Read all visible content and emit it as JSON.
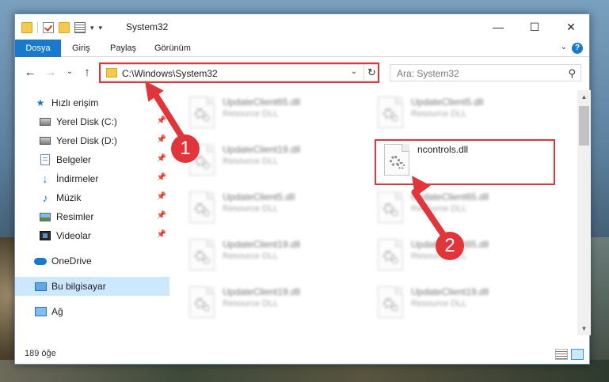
{
  "window": {
    "title": "System32",
    "controls": {
      "minimize": "—",
      "maximize": "☐",
      "close": "✕"
    }
  },
  "quick_access_toolbar": {
    "dropdown": "▾"
  },
  "ribbon": {
    "tabs": [
      "Dosya",
      "Giriş",
      "Paylaş",
      "Görünüm"
    ],
    "expand": "⌄",
    "help": "?"
  },
  "navigation": {
    "back": "←",
    "forward": "→",
    "recent": "⌄",
    "up": "↑",
    "address": "C:\\Windows\\System32",
    "address_dropdown": "⌄",
    "refresh": "↻",
    "search_placeholder": "Ara: System32",
    "search_icon": "⚲"
  },
  "sidebar": {
    "items": [
      {
        "label": "Hızlı erişim",
        "icon": "star-icon",
        "pinned": false
      },
      {
        "label": "Yerel Disk (C:)",
        "icon": "disk-icon",
        "pinned": true
      },
      {
        "label": "Yerel Disk (D:)",
        "icon": "disk-icon",
        "pinned": true
      },
      {
        "label": "Belgeler",
        "icon": "documents-icon",
        "pinned": true
      },
      {
        "label": "İndirmeler",
        "icon": "download-icon",
        "pinned": true
      },
      {
        "label": "Müzik",
        "icon": "music-icon",
        "pinned": true
      },
      {
        "label": "Resimler",
        "icon": "pictures-icon",
        "pinned": true
      },
      {
        "label": "Videolar",
        "icon": "videos-icon",
        "pinned": true
      },
      {
        "label": "OneDrive",
        "icon": "onedrive-icon",
        "pinned": false
      },
      {
        "label": "Bu bilgisayar",
        "icon": "this-pc-icon",
        "pinned": false,
        "selected": true
      },
      {
        "label": "Ağ",
        "icon": "network-icon",
        "pinned": false
      }
    ],
    "pin_glyph": "📌"
  },
  "files": [
    {
      "name": "UpdateClient65.dll",
      "type": "Resource DLL",
      "blurred": true
    },
    {
      "name": "UpdateClient5.dll",
      "type": "Resource DLL",
      "blurred": true
    },
    {
      "name": "UpdateClient19.dll",
      "type": "Resource DLL",
      "blurred": true
    },
    {
      "name": "ncontrols.dll",
      "type": "",
      "blurred": false,
      "highlighted": true
    },
    {
      "name": "UpdateClient5.dll",
      "type": "Resource DLL",
      "blurred": true
    },
    {
      "name": "UpdateClient65.dll",
      "type": "Resource DLL",
      "blurred": true
    },
    {
      "name": "UpdateClient19.dll",
      "type": "Resource DLL",
      "blurred": true
    },
    {
      "name": "UpdateClient65.dll",
      "type": "Resource DLL",
      "blurred": true
    },
    {
      "name": "UpdateClient19.dll",
      "type": "Resource DLL",
      "blurred": true
    },
    {
      "name": "UpdateClient19.dll",
      "type": "Resource DLL",
      "blurred": true
    }
  ],
  "status": {
    "item_count": "189 öğe"
  },
  "annotations": {
    "badge1": "1",
    "badge2": "2",
    "color": "#e0353a"
  },
  "colors": {
    "accent": "#1979ca",
    "selection": "#cce8ff"
  }
}
